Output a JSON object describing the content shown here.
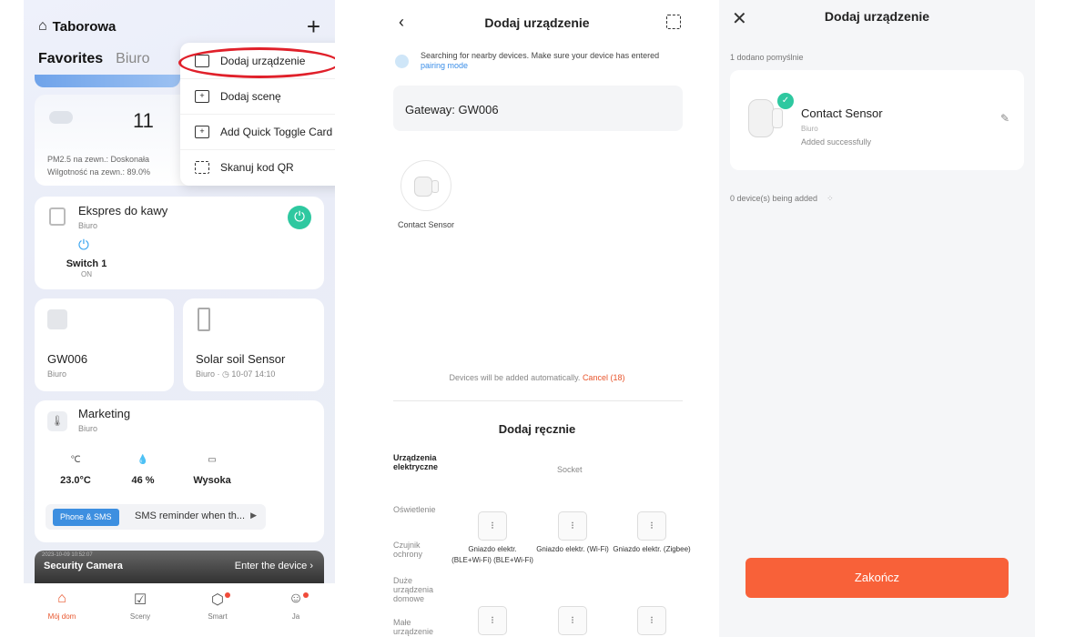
{
  "panel1": {
    "home_name": "Taborowa",
    "tabs": [
      "Favorites",
      "Biuro"
    ],
    "weather": {
      "temp": "11",
      "pm": "PM2.5 na zewn.: Doskonała",
      "humidity": "Wilgotność na zewn.: 89.0%"
    },
    "express": {
      "name": "Ekspres do kawy",
      "room": "Biuro",
      "switch_name": "Switch 1",
      "switch_state": "ON"
    },
    "gw": {
      "name": "GW006",
      "room": "Biuro"
    },
    "solar": {
      "name": "Solar soil Sensor",
      "room": "Biuro",
      "time": "10-07 14:10"
    },
    "marketing": {
      "name": "Marketing",
      "room": "Biuro",
      "stats": [
        {
          "icon": "℃",
          "value": "23.0°C"
        },
        {
          "icon": "💧",
          "value": "46 %"
        },
        {
          "icon": "▭",
          "value": "Wysoka"
        }
      ],
      "sms_tag": "Phone & SMS",
      "sms_text": "SMS reminder when th..."
    },
    "camera": {
      "timestamp": "2023-10-09 10:52:07",
      "name": "Security Camera",
      "enter": "Enter the device"
    },
    "nav": [
      "Mój dom",
      "Sceny",
      "Smart",
      "Ja"
    ],
    "menu": [
      "Dodaj urządzenie",
      "Dodaj scenę",
      "Add Quick Toggle Card",
      "Skanuj kod QR"
    ]
  },
  "panel2": {
    "title": "Dodaj urządzenie",
    "search_text": "Searching for nearby devices. Make sure your device has entered",
    "pairing_link": "pairing mode",
    "gateway": "Gateway: GW006",
    "found": "Contact Sensor",
    "auto_text": "Devices will be added automatically.",
    "cancel": "Cancel (18)",
    "manual_title": "Dodaj ręcznie",
    "categories": [
      "Urządzenia elektryczne",
      "Oświetlenie",
      "Czujnik ochrony",
      "Duże urządzenia domowe",
      "Małe urządzenie"
    ],
    "socket_header": "Socket",
    "products": [
      "Gniazdo elektr. (BLE+Wi-Fi) (BLE+Wi-Fi)",
      "Gniazdo elektr. (Wi-Fi)",
      "Gniazdo elektr. (Zigbee)"
    ]
  },
  "panel3": {
    "title": "Dodaj urządzenie",
    "added_count": "1 dodano pomyślnie",
    "device_name": "Contact Sensor",
    "device_room": "Biuro",
    "device_status": "Added successfully",
    "being_added": "0 device(s) being added",
    "finish": "Zakończ"
  }
}
